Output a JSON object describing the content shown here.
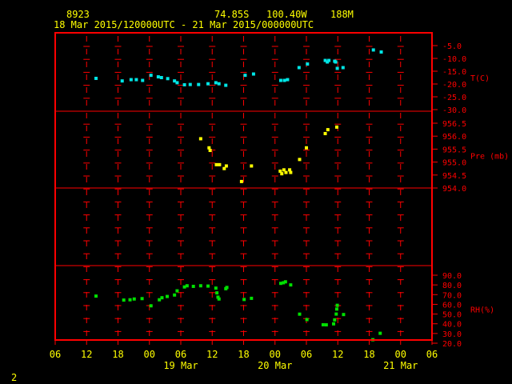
{
  "header": {
    "station_id": "8923",
    "latitude": "74.85S",
    "longitude": "100.40W",
    "elevation": "188M",
    "time_range": "18 Mar 2015/120000UTC - 21 Mar 2015/000000UTC"
  },
  "page_number": "2",
  "colors": {
    "background": "#000000",
    "header_text": "#ffff00",
    "frame": "#ff0000",
    "axis_text": "#ff0000",
    "x_tick_text": "#ffff00",
    "temperature": "#00e5e5",
    "pressure": "#ffff00",
    "humidity": "#00e000"
  },
  "chart_data": {
    "type": "scatter",
    "x_unit": "hours since 18 Mar 2015 06 UTC",
    "xlim": [
      0,
      72
    ],
    "x_tick_labels": [
      "06",
      "12",
      "18",
      "00",
      "06",
      "12",
      "18",
      "00",
      "06",
      "12",
      "18",
      "00",
      "06"
    ],
    "date_labels": [
      {
        "label": "19 Mar",
        "at_hour": 24
      },
      {
        "label": "20 Mar",
        "at_hour": 42
      },
      {
        "label": "21 Mar",
        "at_hour": 66
      }
    ],
    "panels": [
      {
        "id": "temperature",
        "ylabel": "T(C)",
        "ylim": [
          -30,
          -5
        ],
        "ticks": [
          -5.0,
          -10.0,
          -15.0,
          -20.0,
          -25.0,
          -30.0
        ],
        "tick_labels": [
          "-5.0",
          "-10.0",
          "-15.0",
          "-20.0",
          "-25.0",
          "-30.0"
        ],
        "color_key": "temperature",
        "points": [
          [
            7.8,
            -17.8
          ],
          [
            12.8,
            -18.8
          ],
          [
            14.5,
            -18.3
          ],
          [
            15.5,
            -18.3
          ],
          [
            16.7,
            -18.6
          ],
          [
            18.3,
            -16.6
          ],
          [
            19.7,
            -17.2
          ],
          [
            20.3,
            -17.5
          ],
          [
            21.5,
            -17.9
          ],
          [
            22.8,
            -18.8
          ],
          [
            23.3,
            -19.5
          ],
          [
            24.7,
            -20.3
          ],
          [
            25.8,
            -20.2
          ],
          [
            27.4,
            -20.2
          ],
          [
            29.2,
            -19.9
          ],
          [
            30.7,
            -19.5
          ],
          [
            31.3,
            -19.9
          ],
          [
            32.6,
            -20.5
          ],
          [
            36.3,
            -16.6
          ],
          [
            37.9,
            -16.1
          ],
          [
            43.1,
            -18.6
          ],
          [
            43.8,
            -18.6
          ],
          [
            44.4,
            -18.3
          ],
          [
            46.6,
            -13.6
          ],
          [
            48.2,
            -12.2
          ],
          [
            51.6,
            -10.8
          ],
          [
            52.0,
            -11.4
          ],
          [
            52.3,
            -10.8
          ],
          [
            53.4,
            -11.1
          ],
          [
            53.6,
            -11.4
          ],
          [
            53.9,
            -13.9
          ],
          [
            55.0,
            -13.6
          ],
          [
            60.8,
            -6.7
          ],
          [
            62.3,
            -7.5
          ]
        ]
      },
      {
        "id": "pressure",
        "ylabel": "Pre (mb)",
        "ylim": [
          954.0,
          956.5
        ],
        "ticks": [
          956.5,
          956.0,
          955.5,
          955.0,
          954.5,
          954.0
        ],
        "tick_labels": [
          "956.5",
          "956.0",
          "955.5",
          "955.0",
          "954.5",
          "954.0"
        ],
        "color_key": "pressure",
        "points": [
          [
            27.8,
            955.9
          ],
          [
            29.4,
            955.55
          ],
          [
            29.6,
            955.45
          ],
          [
            30.8,
            954.9
          ],
          [
            31.4,
            954.9
          ],
          [
            32.3,
            954.75
          ],
          [
            32.7,
            954.85
          ],
          [
            35.6,
            954.25
          ],
          [
            37.5,
            954.85
          ],
          [
            43.0,
            954.65
          ],
          [
            43.3,
            954.55
          ],
          [
            43.7,
            954.7
          ],
          [
            44.1,
            954.6
          ],
          [
            44.8,
            954.7
          ],
          [
            45.0,
            954.6
          ],
          [
            46.7,
            955.1
          ],
          [
            48.0,
            955.55
          ],
          [
            51.6,
            956.1
          ],
          [
            52.1,
            956.25
          ],
          [
            53.8,
            956.35
          ]
        ]
      },
      {
        "id": "humidity",
        "ylabel": "RH(%)",
        "ylim": [
          20.0,
          90.0
        ],
        "ticks": [
          90.0,
          80.0,
          70.0,
          60.0,
          50.0,
          40.0,
          30.0,
          20.0
        ],
        "tick_labels": [
          "90.0",
          "80.0",
          "70.0",
          "60.0",
          "50.0",
          "40.0",
          "30.0",
          "20.0"
        ],
        "color_key": "humidity",
        "points": [
          [
            7.8,
            68.5
          ],
          [
            13.1,
            64.4
          ],
          [
            14.3,
            64.7
          ],
          [
            15.1,
            65.5
          ],
          [
            16.6,
            65.9
          ],
          [
            18.3,
            58.5
          ],
          [
            19.9,
            64.7
          ],
          [
            20.4,
            66.8
          ],
          [
            21.4,
            68.1
          ],
          [
            22.8,
            69.6
          ],
          [
            23.3,
            73.9
          ],
          [
            24.7,
            77.9
          ],
          [
            25.2,
            79.1
          ],
          [
            26.4,
            78.5
          ],
          [
            27.8,
            79.1
          ],
          [
            29.2,
            78.8
          ],
          [
            30.7,
            76.7
          ],
          [
            30.9,
            71.8
          ],
          [
            31.1,
            67.4
          ],
          [
            31.3,
            65.5
          ],
          [
            32.6,
            76.1
          ],
          [
            32.8,
            77.4
          ],
          [
            36.1,
            65.0
          ],
          [
            37.5,
            66.2
          ],
          [
            43.1,
            81.6
          ],
          [
            43.6,
            82.2
          ],
          [
            44.0,
            83.2
          ],
          [
            45.0,
            80.0
          ],
          [
            46.7,
            49.9
          ],
          [
            48.1,
            44.3
          ],
          [
            51.2,
            39.0
          ],
          [
            51.8,
            38.9
          ],
          [
            53.2,
            39.9
          ],
          [
            53.4,
            44.0
          ],
          [
            53.7,
            50.0
          ],
          [
            53.8,
            55.1
          ],
          [
            53.9,
            59.0
          ],
          [
            55.1,
            49.5
          ],
          [
            60.7,
            23.6
          ],
          [
            62.1,
            30.2
          ]
        ]
      }
    ]
  }
}
